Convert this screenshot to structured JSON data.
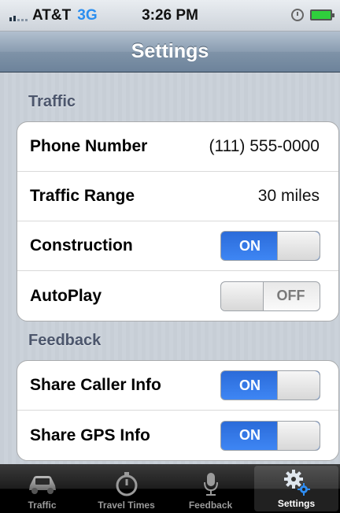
{
  "status_bar": {
    "carrier": "AT&T",
    "network": "3G",
    "time": "3:26 PM"
  },
  "nav": {
    "title": "Settings"
  },
  "sections": [
    {
      "header": "Traffic",
      "rows": [
        {
          "label": "Phone Number",
          "value": "(111) 555-0000"
        },
        {
          "label": "Traffic Range",
          "value": "30 miles"
        },
        {
          "label": "Construction",
          "toggle": "ON"
        },
        {
          "label": "AutoPlay",
          "toggle": "OFF"
        }
      ]
    },
    {
      "header": "Feedback",
      "rows": [
        {
          "label": "Share Caller Info",
          "toggle": "ON"
        },
        {
          "label": "Share GPS Info",
          "toggle": "ON"
        }
      ]
    }
  ],
  "tab_bar": {
    "tabs": [
      {
        "label": "Traffic",
        "icon": "car-icon"
      },
      {
        "label": "Travel Times",
        "icon": "stopwatch-icon"
      },
      {
        "label": "Feedback",
        "icon": "microphone-icon"
      },
      {
        "label": "Settings",
        "icon": "gears-icon",
        "selected": true
      }
    ]
  },
  "colors": {
    "toggle_on": "#3e86f4",
    "nav_bar": "#7f93a8",
    "section_header": "#4c566c",
    "network": "#2a8ef0"
  }
}
